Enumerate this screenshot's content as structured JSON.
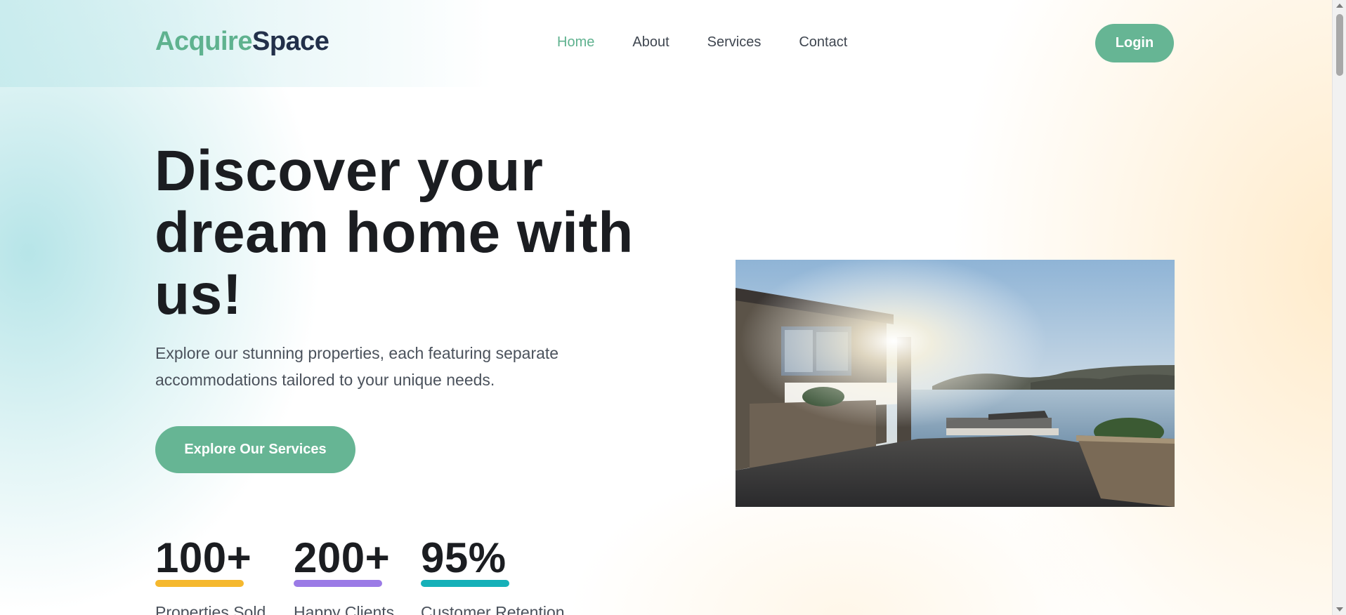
{
  "brand": {
    "part1": "Acquire",
    "part2": "Space"
  },
  "nav": {
    "items": [
      {
        "label": "Home",
        "active": true
      },
      {
        "label": "About",
        "active": false
      },
      {
        "label": "Services",
        "active": false
      },
      {
        "label": "Contact",
        "active": false
      }
    ]
  },
  "header": {
    "login_label": "Login"
  },
  "hero": {
    "title_line1": "Discover your",
    "title_line2": "dream home with",
    "title_line3": "us!",
    "description": "Explore our stunning properties, each featuring separate accommodations tailored to your unique needs.",
    "cta_label": "Explore Our Services"
  },
  "stats": [
    {
      "value": "100+",
      "label": "Properties Sold",
      "color": "#f5b82e"
    },
    {
      "value": "200+",
      "label": "Happy Clients",
      "color": "#9b7be6"
    },
    {
      "value": "95%",
      "label": "Customer Retention",
      "color": "#16b0b8"
    }
  ],
  "colors": {
    "accent": "#66b594",
    "brand_dark": "#22304a",
    "text_dark": "#1b1d21"
  }
}
